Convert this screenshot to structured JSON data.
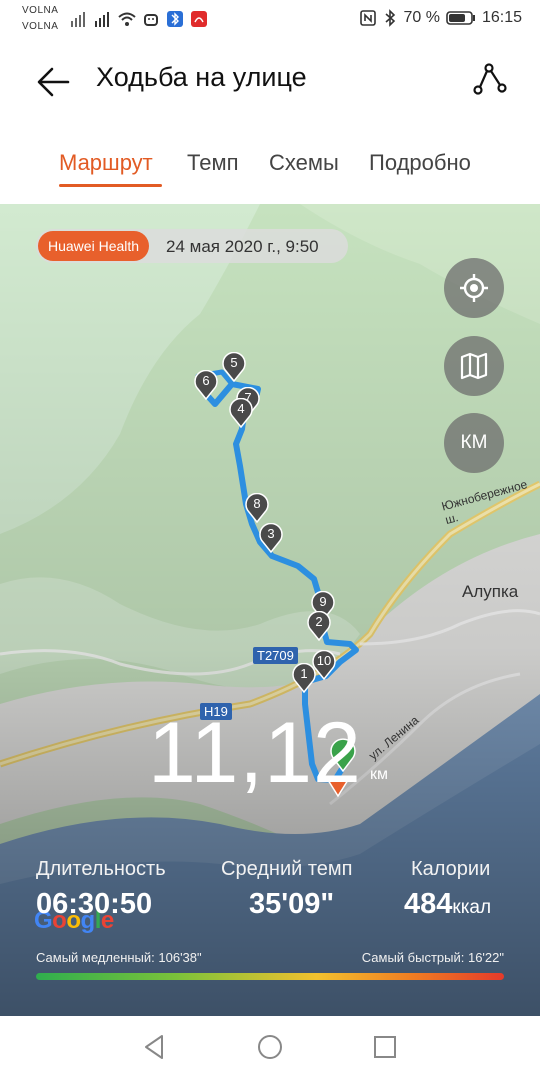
{
  "status_bar": {
    "carrier1": "VOLNA",
    "carrier2": "VOLNA",
    "battery_percent": "70 %",
    "time": "16:15",
    "icons": [
      "signal-icon",
      "wifi-icon",
      "android-icon",
      "bluetooth-app-icon",
      "huawei-app-icon",
      "nfc-icon",
      "bluetooth-icon",
      "battery-icon"
    ]
  },
  "header": {
    "title": "Ходьба на улице",
    "back_icon": "arrow-left-icon",
    "share_icon": "route-share-icon"
  },
  "tabs": [
    {
      "label": "Маршрут",
      "active": true
    },
    {
      "label": "Темп",
      "active": false
    },
    {
      "label": "Схемы",
      "active": false
    },
    {
      "label": "Подробно",
      "active": false
    }
  ],
  "map": {
    "badge": "Huawei Health",
    "date": "24 мая 2020 г., 9:50",
    "buttons": [
      "locate-icon",
      "map-layers-icon",
      "КМ"
    ],
    "labels": {
      "road": "Южнобережное ш.",
      "town": "Алупка",
      "street": "ул. Ленина",
      "tag_t2709": "T2709",
      "tag_h19": "H19",
      "google": "Google"
    },
    "markers": [
      "5",
      "6",
      "7",
      "4",
      "8",
      "3",
      "9",
      "2",
      "10",
      "1"
    ],
    "distance": "11,12",
    "distance_unit": "км"
  },
  "stats": {
    "duration_label": "Длительность",
    "duration_value": "06:30:50",
    "pace_label": "Средний темп",
    "pace_value": "35'09\"",
    "calories_label": "Калории",
    "calories_value": "484",
    "calories_unit": "ккал",
    "slowest": "Самый медленный: 106'38\"",
    "fastest": "Самый быстрый: 16'22\""
  },
  "colors": {
    "accent": "#e25b24",
    "route": "#2d8fe0",
    "sea": "#6b8fb8"
  },
  "nav": [
    "back-triangle-icon",
    "home-circle-icon",
    "recents-square-icon"
  ]
}
